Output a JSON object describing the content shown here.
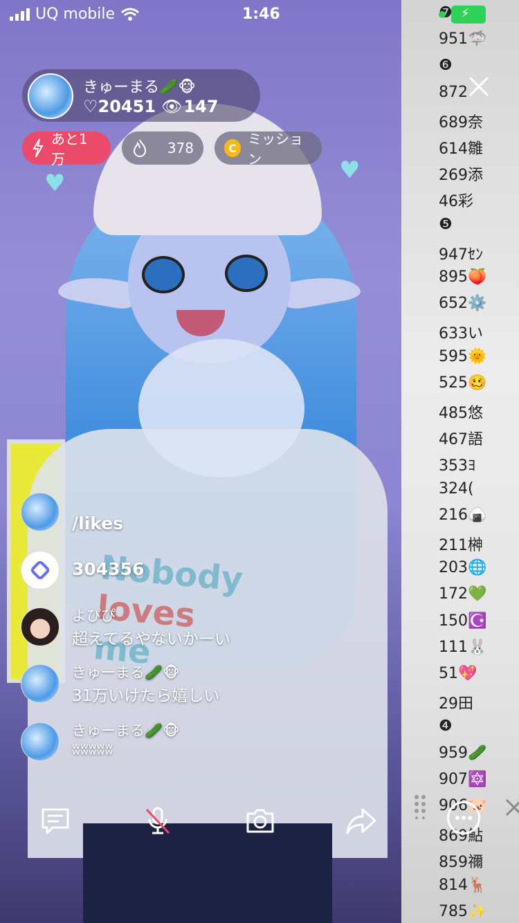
{
  "status_bar": {
    "carrier": "UQ mobile",
    "time": "1:46"
  },
  "host": {
    "name": "きゅーまる🥒🐵",
    "likes": "♡20451",
    "viewers": "147"
  },
  "chips": {
    "goal": "あと1万",
    "fire_count": "378",
    "mission": "ミッション",
    "coin_letter": "C"
  },
  "comments": [
    {
      "name": "",
      "text": "/likes"
    },
    {
      "name": "",
      "text": "304356"
    },
    {
      "name": "よぴぴ",
      "text": "超えてるやないかーい"
    },
    {
      "name": "きゅーまる🥒🐵",
      "text": "31万いけたら嬉しい"
    },
    {
      "name": "きゅーまる🥒🐵",
      "text": "ʬʬʬʬʬ"
    }
  ],
  "shirt_text": [
    "Nobody",
    "loves",
    "me"
  ],
  "ranking_panel": {
    "rows": [
      "❼",
      "951🦈",
      "❻",
      "872",
      "689奈",
      "614雛",
      "269添",
      "46彩",
      "❺",
      "947ｾﾝ",
      "895🍑",
      "652⚙️",
      "633い",
      "595🌞",
      "525🥴",
      "485悠",
      "467語",
      "353ﾖ",
      "324(",
      "216🍙",
      "211榊",
      "203🌐",
      "172💚",
      "150☪️",
      "111🐰",
      "51💖",
      "29田",
      "❹",
      "959🥒",
      "907🔯",
      "906🐷",
      "869鮎",
      "859禰",
      "814🦌",
      "785✨"
    ]
  },
  "colors": {
    "accent_red": "#ec4a6b",
    "coin": "#f7b916",
    "online": "#2fd158"
  },
  "icons": [
    "signal-icon",
    "wifi-icon",
    "heart-icon",
    "eye-icon",
    "bolt-icon",
    "fire-icon",
    "comment-icon",
    "mic-muted-icon",
    "camera-icon",
    "share-icon",
    "more-icon",
    "drag-handle-icon",
    "close-icon"
  ]
}
